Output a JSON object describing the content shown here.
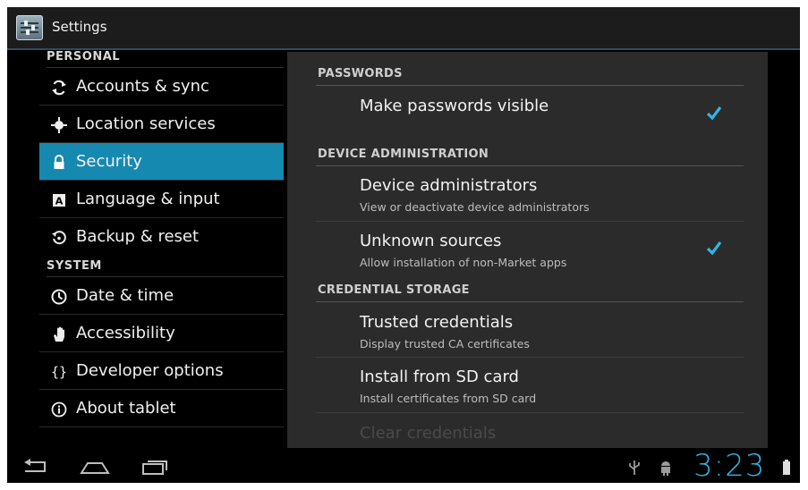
{
  "app": {
    "title": "Settings",
    "icon": "settings-sliders-icon"
  },
  "left_pane": {
    "personal_header": "PERSONAL",
    "system_header": "SYSTEM",
    "items": [
      {
        "label": "Accounts & sync",
        "icon": "sync-icon"
      },
      {
        "label": "Location services",
        "icon": "location-icon"
      },
      {
        "label": "Security",
        "icon": "lock-icon",
        "selected": true
      },
      {
        "label": "Language & input",
        "icon": "keyboard-icon"
      },
      {
        "label": "Backup & reset",
        "icon": "backup-icon"
      },
      {
        "label": "Date & time",
        "icon": "clock-icon"
      },
      {
        "label": "Accessibility",
        "icon": "hand-icon"
      },
      {
        "label": "Developer options",
        "icon": "braces-icon"
      },
      {
        "label": "About tablet",
        "icon": "info-icon"
      }
    ]
  },
  "right_pane": {
    "sections": [
      {
        "header": "PASSWORDS"
      },
      {
        "header": "DEVICE ADMINISTRATION"
      },
      {
        "header": "CREDENTIAL STORAGE"
      }
    ],
    "prefs": [
      {
        "title": "Make passwords visible",
        "summary": "",
        "checked": true
      },
      {
        "title": "Device administrators",
        "summary": "View or deactivate device administrators"
      },
      {
        "title": "Unknown sources",
        "summary": "Allow installation of non-Market apps",
        "checked": true
      },
      {
        "title": "Trusted credentials",
        "summary": "Display trusted CA certificates"
      },
      {
        "title": "Install from SD card",
        "summary": "Install certificates from SD card"
      },
      {
        "title": "Clear credentials",
        "summary": "",
        "disabled": true
      }
    ]
  },
  "navbar": {
    "buttons": [
      "back-icon",
      "home-icon",
      "recent-apps-icon"
    ],
    "status_icons": [
      "usb-icon",
      "android-debug-icon",
      "battery-icon"
    ],
    "clock": "3:23"
  },
  "colors": {
    "accent": "#33b5e5",
    "selected_bg": "#1689b0",
    "panel_bg": "#2b2b2b"
  }
}
